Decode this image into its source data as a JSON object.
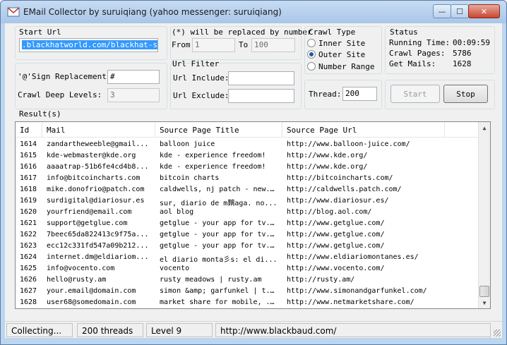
{
  "window": {
    "title": "EMail Collector by suruiqiang (yahoo messenger: suruiqiang)",
    "controls": {
      "minimize": "—",
      "maximize": "☐",
      "close": "✕"
    }
  },
  "start_url": {
    "heading": "Start Url",
    "value": ".blackhatworld.com/blackhat-seo/"
  },
  "replace": {
    "heading": "(*) will be replaced by number",
    "from_label": "From",
    "from_value": "1",
    "to_label": "To",
    "to_value": "100"
  },
  "crawl_type": {
    "heading": "Crawl Type",
    "options": [
      "Inner Site",
      "Outer Site",
      "Number Range"
    ],
    "selected": "Outer Site"
  },
  "status": {
    "heading": "Status",
    "running_time_label": "Running Time:",
    "running_time_value": "00:09:59",
    "crawl_pages_label": "Crawl Pages:",
    "crawl_pages_value": "5786",
    "get_mails_label": "Get Mails:",
    "get_mails_value": "1628"
  },
  "options": {
    "sign_label": "'@'Sign Replacement:",
    "sign_value": "#",
    "crawl_deep_label": "Crawl Deep Levels:",
    "crawl_deep_value": "3"
  },
  "url_filter": {
    "heading": "Url Filter",
    "include_label": "Url Include:",
    "include_value": "",
    "exclude_label": "Url Exclude:",
    "exclude_value": ""
  },
  "thread": {
    "label": "Thread:",
    "value": "200"
  },
  "buttons": {
    "start": "Start",
    "stop": "Stop"
  },
  "results": {
    "heading": "Result(s)",
    "columns": [
      "Id",
      "Mail",
      "Source Page Title",
      "Source Page Url"
    ],
    "rows": [
      [
        "1614",
        "zandartheweeble@gmail...",
        "balloon juice",
        "http://www.balloon-juice.com/"
      ],
      [
        "1615",
        "kde-webmaster@kde.org",
        "kde - experience freedom!",
        "http://www.kde.org/"
      ],
      [
        "1616",
        "aaaatrap-51b6fe4cd4b8...",
        "kde - experience freedom!",
        "http://www.kde.org/"
      ],
      [
        "1617",
        "info@bitcoincharts.com",
        "bitcoin charts",
        "http://bitcoincharts.com/"
      ],
      [
        "1618",
        "mike.donofrio@patch.com",
        "caldwells, nj patch - new...",
        "http://caldwells.patch.com/"
      ],
      [
        "1619",
        "surdigital@diariosur.es",
        "sur, diario de m麶aga. no...",
        "http://www.diariosur.es/"
      ],
      [
        "1620",
        "yourfriend@email.com",
        "aol blog",
        "http://blog.aol.com/"
      ],
      [
        "1621",
        "support@getglue.com",
        "getglue - your app for tv...",
        "http://www.getglue.com/"
      ],
      [
        "1622",
        "7beec65da822413c9f75a...",
        "getglue - your app for tv...",
        "http://www.getglue.com/"
      ],
      [
        "1623",
        "ecc12c331fd547a09b212...",
        "getglue - your app for tv...",
        "http://www.getglue.com/"
      ],
      [
        "1624",
        "internet.dm@eldiariom...",
        "el diario monta彡s: el di...",
        "http://www.eldiariomontanes.es/"
      ],
      [
        "1625",
        "info@vocento.com",
        "vocento",
        "http://www.vocento.com/"
      ],
      [
        "1626",
        "hello@rusty.am",
        "rusty meadows | rusty.am",
        "http://rusty.am/"
      ],
      [
        "1627",
        "your.email@domain.com",
        "simon &amp; garfunkel | t...",
        "http://www.simonandgarfunkel.com/"
      ],
      [
        "1628",
        "user68@somedomain.com",
        "market share for mobile, ...",
        "http://www.netmarketshare.com/"
      ]
    ]
  },
  "statusbar": {
    "state": "Collecting...",
    "threads": "200 threads",
    "level": "Level 9",
    "url": "http://www.blackbaud.com/"
  }
}
